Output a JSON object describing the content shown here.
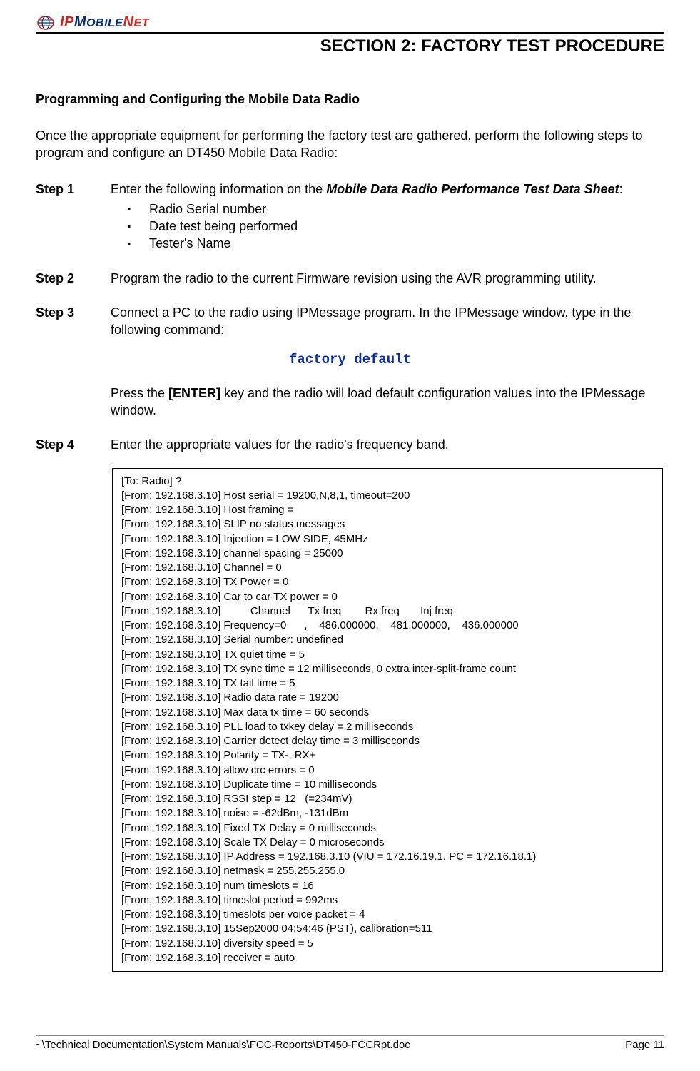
{
  "header": {
    "logo_prefix": "IP",
    "logo_mid": "M",
    "logo_mobile": "OBILE",
    "logo_net_n": "N",
    "logo_net_et": "ET",
    "section_title": "SECTION 2:  FACTORY TEST PROCEDURE"
  },
  "subheading": "Programming and Configuring the Mobile Data Radio",
  "intro": "Once the appropriate equipment for performing the factory test are gathered, perform the following steps to program and configure an DT450 Mobile Data Radio:",
  "step1": {
    "label": "Step 1",
    "pre": "Enter the following information on the ",
    "emph": "Mobile Data Radio Performance Test Data Sheet",
    "post": ":",
    "bullets": [
      "Radio Serial number",
      "Date test being performed",
      "Tester's Name"
    ]
  },
  "step2": {
    "label": "Step 2",
    "text": "Program the radio to the current Firmware revision using the AVR programming utility."
  },
  "step3": {
    "label": "Step 3",
    "text": "Connect a PC to the radio using IPMessage program.  In the IPMessage window, type in the following command:",
    "command": "factory default",
    "press_pre": "Press the ",
    "enter_key": "[ENTER]",
    "press_post": " key and the radio will load default configuration values into the IPMessage window."
  },
  "step4": {
    "label": "Step 4",
    "text": "Enter the appropriate values for the radio's frequency band."
  },
  "terminal": "[To: Radio] ?\n[From: 192.168.3.10] Host serial = 19200,N,8,1, timeout=200\n[From: 192.168.3.10] Host framing =\n[From: 192.168.3.10] SLIP no status messages\n[From: 192.168.3.10] Injection = LOW SIDE, 45MHz\n[From: 192.168.3.10] channel spacing = 25000\n[From: 192.168.3.10] Channel = 0\n[From: 192.168.3.10] TX Power = 0\n[From: 192.168.3.10] Car to car TX power = 0\n[From: 192.168.3.10]          Channel      Tx freq        Rx freq       Inj freq\n[From: 192.168.3.10] Frequency=0      ,    486.000000,    481.000000,    436.000000\n[From: 192.168.3.10] Serial number: undefined\n[From: 192.168.3.10] TX quiet time = 5\n[From: 192.168.3.10] TX sync time = 12 milliseconds, 0 extra inter-split-frame count\n[From: 192.168.3.10] TX tail time = 5\n[From: 192.168.3.10] Radio data rate = 19200\n[From: 192.168.3.10] Max data tx time = 60 seconds\n[From: 192.168.3.10] PLL load to txkey delay = 2 milliseconds\n[From: 192.168.3.10] Carrier detect delay time = 3 milliseconds\n[From: 192.168.3.10] Polarity = TX-, RX+\n[From: 192.168.3.10] allow crc errors = 0\n[From: 192.168.3.10] Duplicate time = 10 milliseconds\n[From: 192.168.3.10] RSSI step = 12   (=234mV)\n[From: 192.168.3.10] noise = -62dBm, -131dBm\n[From: 192.168.3.10] Fixed TX Delay = 0 milliseconds\n[From: 192.168.3.10] Scale TX Delay = 0 microseconds\n[From: 192.168.3.10] IP Address = 192.168.3.10 (VIU = 172.16.19.1, PC = 172.16.18.1)\n[From: 192.168.3.10] netmask = 255.255.255.0\n[From: 192.168.3.10] num timeslots = 16\n[From: 192.168.3.10] timeslot period = 992ms\n[From: 192.168.3.10] timeslots per voice packet = 4\n[From: 192.168.3.10] 15Sep2000 04:54:46 (PST), calibration=511\n[From: 192.168.3.10] diversity speed = 5\n[From: 192.168.3.10] receiver = auto",
  "footer": {
    "path": "~\\Technical Documentation\\System Manuals\\FCC-Reports\\DT450-FCCRpt.doc",
    "page": "Page 11"
  }
}
